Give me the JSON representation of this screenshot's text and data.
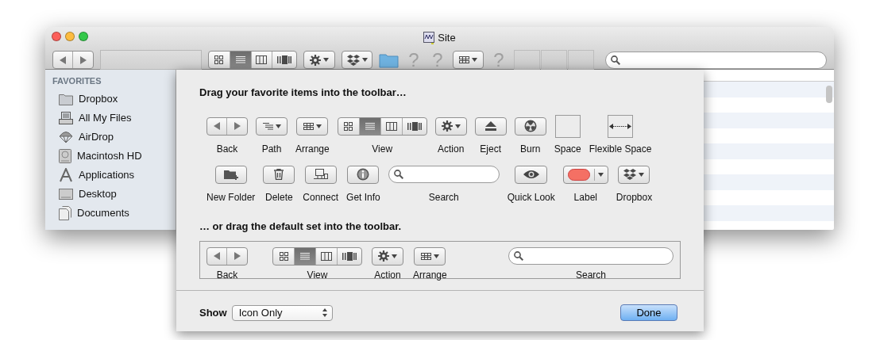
{
  "window": {
    "title": "Site"
  },
  "toolbar": [
    {
      "kind": "nav"
    },
    {
      "kind": "slot"
    },
    {
      "kind": "view",
      "segments": [
        {
          "selected": false
        },
        {
          "selected": true
        },
        {
          "selected": false
        },
        {
          "selected": false
        }
      ]
    },
    {
      "kind": "action"
    },
    {
      "kind": "dropbox"
    },
    {
      "kind": "folder"
    },
    {
      "kind": "unknown",
      "glyph": "?"
    },
    {
      "kind": "unknown",
      "glyph": "?"
    },
    {
      "kind": "arrange"
    },
    {
      "kind": "unknown",
      "glyph": "?"
    },
    {
      "kind": "blank"
    },
    {
      "kind": "blank"
    },
    {
      "kind": "blank"
    },
    {
      "kind": "search"
    }
  ],
  "sidebar": {
    "heading": "FAVORITES",
    "items": [
      {
        "label": "Dropbox"
      },
      {
        "label": "All My Files"
      },
      {
        "label": "AirDrop"
      },
      {
        "label": "Macintosh HD"
      },
      {
        "label": "Applications"
      },
      {
        "label": "Desktop"
      },
      {
        "label": "Documents"
      }
    ]
  },
  "sheet": {
    "heading": "Drag your favorite items into the toolbar…",
    "items": [
      {
        "kind": "nav",
        "label": "Back"
      },
      {
        "kind": "path",
        "label": "Path"
      },
      {
        "kind": "arrange",
        "label": "Arrange"
      },
      {
        "kind": "view",
        "label": "View",
        "segments": [
          {
            "selected": false
          },
          {
            "selected": true
          },
          {
            "selected": false
          },
          {
            "selected": false
          }
        ]
      },
      {
        "kind": "action",
        "label": "Action"
      },
      {
        "kind": "eject",
        "label": "Eject"
      },
      {
        "kind": "burn",
        "label": "Burn"
      },
      {
        "kind": "space",
        "label": "Space"
      },
      {
        "kind": "flexspace",
        "label": "Flexible Space"
      },
      {
        "kind": "newfolder",
        "label": "New Folder"
      },
      {
        "kind": "delete",
        "label": "Delete"
      },
      {
        "kind": "connect",
        "label": "Connect"
      },
      {
        "kind": "info",
        "label": "Get Info"
      },
      {
        "kind": "search",
        "label": "Search"
      },
      {
        "kind": "quicklook",
        "label": "Quick Look"
      },
      {
        "kind": "label",
        "label": "Label"
      },
      {
        "kind": "dropbox",
        "label": "Dropbox"
      }
    ],
    "default_heading": "… or drag the default set into the toolbar.",
    "default_set": [
      {
        "kind": "nav",
        "label": "Back"
      },
      {
        "kind": "view",
        "label": "View",
        "segments": [
          {
            "selected": false
          },
          {
            "selected": true
          },
          {
            "selected": false
          },
          {
            "selected": false
          }
        ]
      },
      {
        "kind": "action",
        "label": "Action"
      },
      {
        "kind": "arrange",
        "label": "Arrange"
      },
      {
        "kind": "search",
        "label": "Search"
      }
    ],
    "show_label": "Show",
    "show_value": "Icon Only",
    "done": "Done"
  }
}
